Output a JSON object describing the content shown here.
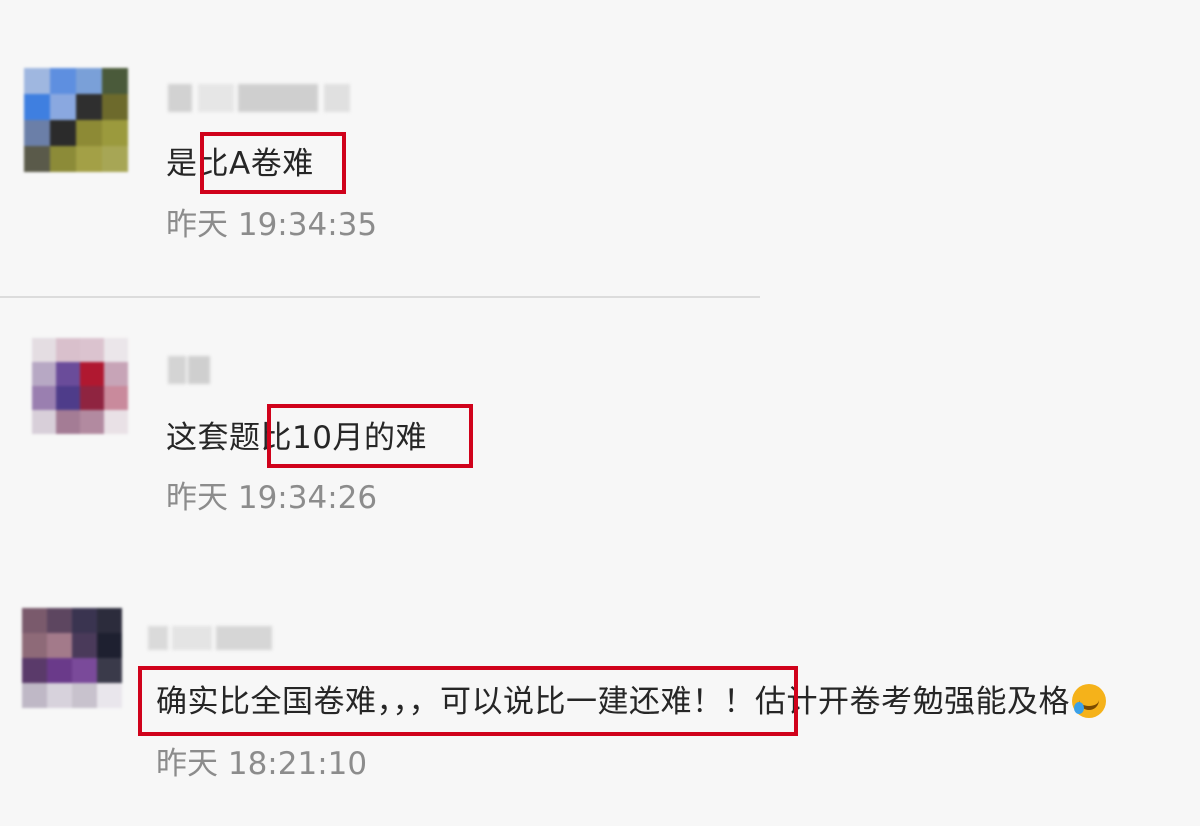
{
  "comments": [
    {
      "text": "是比A卷难",
      "timestamp": "昨天 19:34:35",
      "highlight": "比A卷难"
    },
    {
      "text": "这套题比10月的难",
      "timestamp": "昨天 19:34:26",
      "highlight": "比10月的难"
    },
    {
      "text_highlighted": "确实比全国卷难，，，可以说比一建还难！",
      "text_rest": "！估计开卷考勉强能及格",
      "emoji": "crying-laughing-emoji",
      "timestamp": "昨天 18:21:10"
    }
  ],
  "colors": {
    "highlight_border": "#d0021b",
    "timestamp": "#8c8c8c",
    "background": "#f7f7f7"
  }
}
